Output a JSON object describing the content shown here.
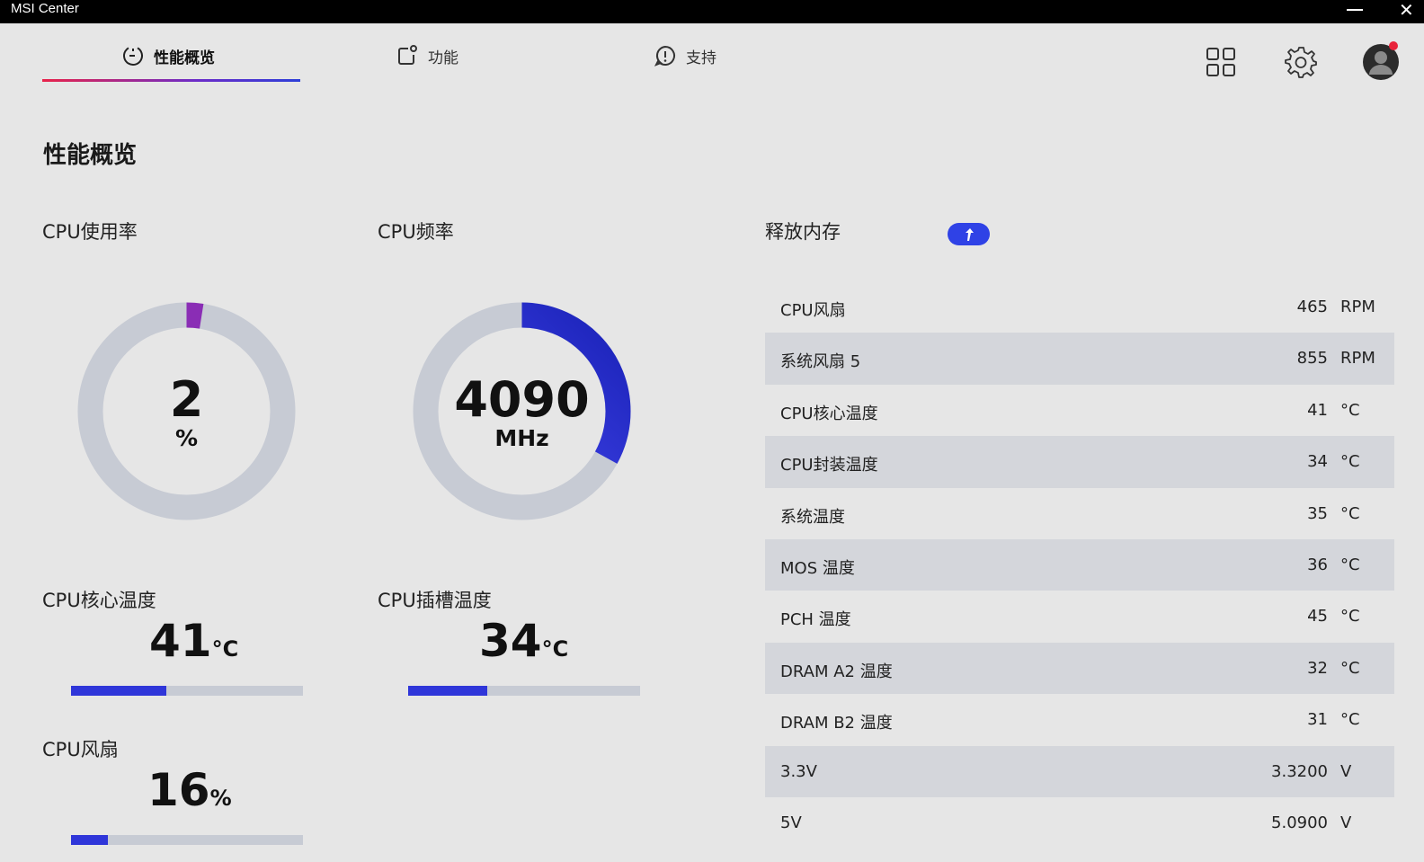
{
  "window": {
    "title": "MSI Center",
    "minimize": "—",
    "close": "✕"
  },
  "tabs": [
    {
      "label": "性能概览",
      "icon": "dashboard-icon",
      "active": true
    },
    {
      "label": "功能",
      "icon": "features-icon",
      "active": false
    },
    {
      "label": "支持",
      "icon": "support-icon",
      "active": false
    }
  ],
  "header_icons": [
    "grid-icon",
    "gear-icon",
    "avatar"
  ],
  "page_title": "性能概览",
  "cpu_usage": {
    "label": "CPU使用率",
    "value": "2",
    "unit": "%",
    "fraction": 0.02
  },
  "cpu_freq": {
    "label": "CPU频率",
    "value": "4090",
    "unit": "MHz",
    "fraction": 0.33
  },
  "cpu_core_temp": {
    "label": "CPU核心温度",
    "value": "41",
    "unit": "°C",
    "bar_fraction": 0.41
  },
  "cpu_socket_temp": {
    "label": "CPU插槽温度",
    "value": "34",
    "unit": "°C",
    "bar_fraction": 0.34
  },
  "cpu_fan": {
    "label": "CPU风扇",
    "value": "16",
    "unit": "%",
    "bar_fraction": 0.16
  },
  "release_memory": {
    "label": "释放内存"
  },
  "sensors": [
    {
      "name": "CPU风扇",
      "value": "465",
      "unit": "RPM"
    },
    {
      "name": "系统风扇 5",
      "value": "855",
      "unit": "RPM"
    },
    {
      "name": "CPU核心温度",
      "value": "41",
      "unit": "°C"
    },
    {
      "name": "CPU封装温度",
      "value": "34",
      "unit": "°C"
    },
    {
      "name": "系统温度",
      "value": "35",
      "unit": "°C"
    },
    {
      "name": "MOS 温度",
      "value": "36",
      "unit": "°C"
    },
    {
      "name": "PCH 温度",
      "value": "45",
      "unit": "°C"
    },
    {
      "name": "DRAM A2 温度",
      "value": "32",
      "unit": "°C"
    },
    {
      "name": "DRAM B2 温度",
      "value": "31",
      "unit": "°C"
    },
    {
      "name": "3.3V",
      "value": "3.3200",
      "unit": "V"
    },
    {
      "name": "5V",
      "value": "5.0900",
      "unit": "V"
    }
  ],
  "colors": {
    "accent_blue": "#2f36d9",
    "accent_purple": "#8a2db5",
    "track": "#c7cbd4",
    "notification": "#e8233a"
  }
}
